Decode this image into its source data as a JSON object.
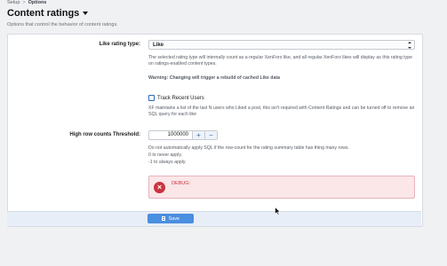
{
  "breadcrumb": {
    "setup": "Setup",
    "sep": ">",
    "options": "Options"
  },
  "page": {
    "title": "Content ratings",
    "description": "Options that control the behavior of content ratings."
  },
  "like_rating_type": {
    "label": "Like rating type:",
    "value": "Like",
    "hint": "The selected rating type will internally count as a regular XenForo like, and all regular XenForo likes will display as this rating type on ratings-enabled content types.",
    "warning": "Warning: Changing will trigger a rebuild of cached Like data"
  },
  "track_recent": {
    "label": "Track Recent Users",
    "checked": false,
    "hint": "XF maintains a list of the last N users who Liked a post, this isn't required with Content Ratings and can be turned off to remove an SQL query for each like"
  },
  "high_row": {
    "label": "High row counts Threshold:",
    "value": "1000000",
    "plus": "+",
    "minus": "−",
    "hint1": "Do not automatically apply SQL if the row-count for the rating summary table has thing many rows.",
    "hint2": "0 to never apply.",
    "hint3": "-1 to always apply."
  },
  "debug": {
    "icon": "x-circle-icon",
    "label": "DEBUG:"
  },
  "footer": {
    "save_label": "Save"
  },
  "colors": {
    "accent": "#4a8ee0",
    "error": "#c9343f",
    "error_bg": "#fbe6e8"
  }
}
